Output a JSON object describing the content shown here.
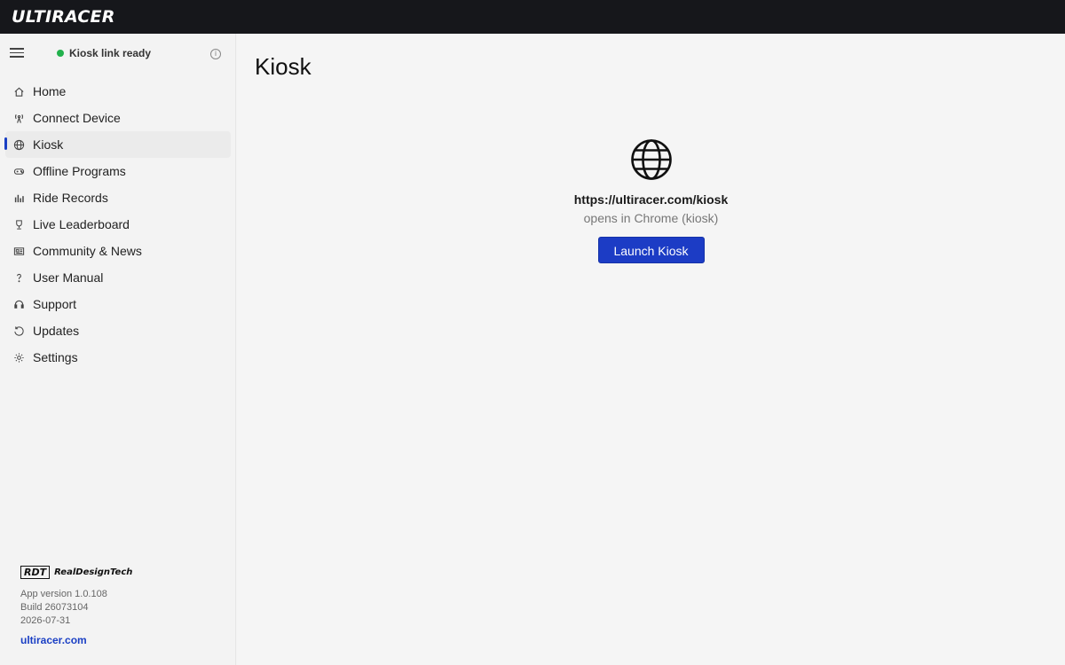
{
  "app": {
    "logo": "ULTIRACER"
  },
  "sidebar": {
    "status_text": "Kiosk link ready",
    "status_color": "#22b14c",
    "items": [
      {
        "label": "Home",
        "icon": "home-icon",
        "active": false
      },
      {
        "label": "Connect Device",
        "icon": "antenna-icon",
        "active": false
      },
      {
        "label": "Kiosk",
        "icon": "globe-icon",
        "active": true
      },
      {
        "label": "Offline Programs",
        "icon": "gamepad-icon",
        "active": false
      },
      {
        "label": "Ride Records",
        "icon": "bar-chart-icon",
        "active": false
      },
      {
        "label": "Live Leaderboard",
        "icon": "trophy-icon",
        "active": false
      },
      {
        "label": "Community & News",
        "icon": "newspaper-icon",
        "active": false
      },
      {
        "label": "User Manual",
        "icon": "question-icon",
        "active": false
      },
      {
        "label": "Support",
        "icon": "headset-icon",
        "active": false
      },
      {
        "label": "Updates",
        "icon": "refresh-icon",
        "active": false
      },
      {
        "label": "Settings",
        "icon": "gear-icon",
        "active": false
      }
    ],
    "footer": {
      "brand_mark": "RDT",
      "brand_name": "RealDesignTech",
      "version": "App version 1.0.108",
      "build": "Build 26073104",
      "date": "2026-07-31",
      "link": "ultiracer.com"
    }
  },
  "main": {
    "title": "Kiosk",
    "url": "https://ultiracer.com/kiosk",
    "subtitle": "opens in Chrome (kiosk)",
    "button_label": "Launch Kiosk"
  },
  "colors": {
    "accent": "#1c3cc5",
    "topbar": "#16171b"
  }
}
